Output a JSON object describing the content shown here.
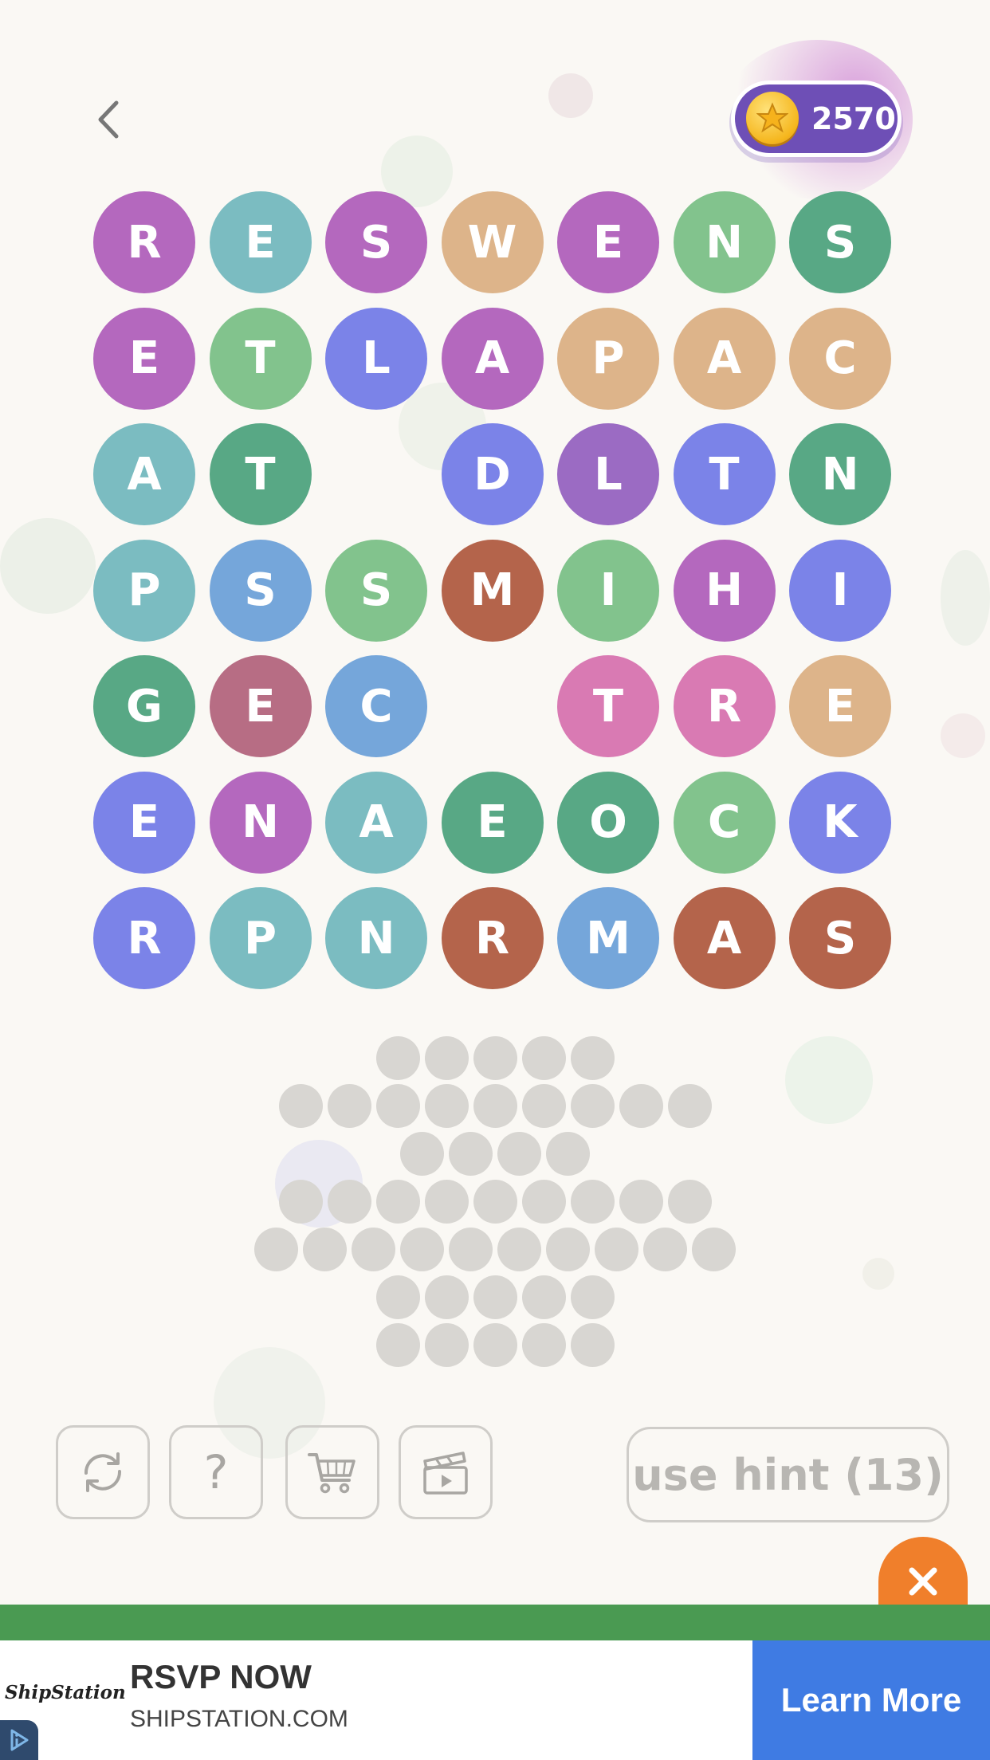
{
  "header": {
    "back_icon": "chevron-left-icon",
    "coins": "2570",
    "coin_icon": "gold-star-coin-icon"
  },
  "board": {
    "colors": {
      "purple": "#b468be",
      "teal": "#7bbcc1",
      "tan": "#ddb48a",
      "lightgreen": "#82c38d",
      "darkgreen": "#58a885",
      "blueviolet": "#7b83e8",
      "violet": "#9b6bc3",
      "blue": "#75a6da",
      "rust": "#b4644b",
      "mauve": "#b76d84",
      "pink": "#d97ab3"
    },
    "rows": [
      [
        {
          "l": "R",
          "c": "purple"
        },
        {
          "l": "E",
          "c": "teal"
        },
        {
          "l": "S",
          "c": "purple"
        },
        {
          "l": "W",
          "c": "tan"
        },
        {
          "l": "E",
          "c": "purple"
        },
        {
          "l": "N",
          "c": "lightgreen"
        },
        {
          "l": "S",
          "c": "darkgreen"
        }
      ],
      [
        {
          "l": "E",
          "c": "purple"
        },
        {
          "l": "T",
          "c": "lightgreen"
        },
        {
          "l": "L",
          "c": "blueviolet"
        },
        {
          "l": "A",
          "c": "purple"
        },
        {
          "l": "P",
          "c": "tan"
        },
        {
          "l": "A",
          "c": "tan"
        },
        {
          "l": "C",
          "c": "tan"
        }
      ],
      [
        {
          "l": "A",
          "c": "teal"
        },
        {
          "l": "T",
          "c": "darkgreen"
        },
        null,
        {
          "l": "D",
          "c": "blueviolet"
        },
        {
          "l": "L",
          "c": "violet"
        },
        {
          "l": "T",
          "c": "blueviolet"
        },
        {
          "l": "N",
          "c": "darkgreen"
        }
      ],
      [
        {
          "l": "P",
          "c": "teal"
        },
        {
          "l": "S",
          "c": "blue"
        },
        {
          "l": "S",
          "c": "lightgreen"
        },
        {
          "l": "M",
          "c": "rust"
        },
        {
          "l": "I",
          "c": "lightgreen"
        },
        {
          "l": "H",
          "c": "purple"
        },
        {
          "l": "I",
          "c": "blueviolet"
        }
      ],
      [
        {
          "l": "G",
          "c": "darkgreen"
        },
        {
          "l": "E",
          "c": "mauve"
        },
        {
          "l": "C",
          "c": "blue"
        },
        null,
        {
          "l": "T",
          "c": "pink"
        },
        {
          "l": "R",
          "c": "pink"
        },
        {
          "l": "E",
          "c": "tan"
        }
      ],
      [
        {
          "l": "E",
          "c": "blueviolet"
        },
        {
          "l": "N",
          "c": "purple"
        },
        {
          "l": "A",
          "c": "teal"
        },
        {
          "l": "E",
          "c": "darkgreen"
        },
        {
          "l": "O",
          "c": "darkgreen"
        },
        {
          "l": "C",
          "c": "lightgreen"
        },
        {
          "l": "K",
          "c": "blueviolet"
        }
      ],
      [
        {
          "l": "R",
          "c": "blueviolet"
        },
        {
          "l": "P",
          "c": "teal"
        },
        {
          "l": "N",
          "c": "teal"
        },
        {
          "l": "R",
          "c": "rust"
        },
        {
          "l": "M",
          "c": "blue"
        },
        {
          "l": "A",
          "c": "rust"
        },
        {
          "l": "S",
          "c": "rust"
        }
      ]
    ]
  },
  "answer_slots": {
    "word_lengths": [
      5,
      9,
      4,
      9,
      10,
      5,
      5
    ]
  },
  "toolbar": {
    "shuffle_icon": "shuffle-icon",
    "help_label": "?",
    "shop_icon": "cart-icon",
    "video_icon": "clapperboard-icon",
    "hint_label": "use hint (13)"
  },
  "ad": {
    "close_icon": "close-icon",
    "logo_text": "ShipStation",
    "headline": "RSVP NOW",
    "domain": "SHIPSTATION.COM",
    "cta": "Learn More",
    "adchoices_icon": "adchoices-icon"
  }
}
